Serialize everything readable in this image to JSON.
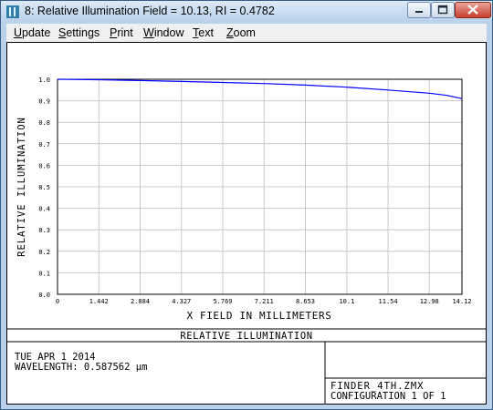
{
  "window": {
    "title": "8: Relative Illumination Field = 10.13, RI = 0.4782",
    "minimize_label": "",
    "maximize_label": "",
    "close_label": ""
  },
  "menu": {
    "items": [
      "Update",
      "Settings",
      "Print",
      "Window",
      "Text",
      "Zoom"
    ]
  },
  "plot": {
    "ylabel": "RELATIVE ILLUMINATION",
    "xlabel": "X FIELD IN MILLIMETERS",
    "footer_title": "RELATIVE ILLUMINATION",
    "date": "TUE APR 1 2014",
    "wavelength": "WAVELENGTH: 0.587562 µm",
    "filename": "FINDER_4TH.ZMX",
    "configuration": "CONFIGURATION 1 OF 1"
  },
  "chart_data": {
    "type": "line",
    "xlabel": "X FIELD IN MILLIMETERS",
    "ylabel": "RELATIVE ILLUMINATION",
    "xlim": [
      0,
      14.12
    ],
    "ylim": [
      0.0,
      1.0
    ],
    "x_ticks": [
      "0",
      "1.442",
      "2.884",
      "4.327",
      "5.769",
      "7.211",
      "8.653",
      "10.1",
      "11.54",
      "12.98",
      "14.12"
    ],
    "x_tick_values": [
      0,
      1.442,
      2.884,
      4.327,
      5.769,
      7.211,
      8.653,
      10.1,
      11.54,
      12.98,
      14.12
    ],
    "y_ticks": [
      "0.0",
      "0.1",
      "0.2",
      "0.3",
      "0.4",
      "0.5",
      "0.6",
      "0.7",
      "0.8",
      "0.9",
      "1.0"
    ],
    "y_tick_values": [
      0.0,
      0.1,
      0.2,
      0.3,
      0.4,
      0.5,
      0.6,
      0.7,
      0.8,
      0.9,
      1.0
    ],
    "grid": true,
    "series": [
      {
        "color": "#0000ff",
        "x": [
          0,
          1.442,
          2.884,
          4.327,
          5.769,
          7.211,
          8.653,
          10.1,
          11.54,
          12.98,
          13.6,
          14.12
        ],
        "y": [
          1.0,
          0.998,
          0.994,
          0.99,
          0.985,
          0.98,
          0.973,
          0.963,
          0.95,
          0.935,
          0.925,
          0.91
        ]
      }
    ]
  }
}
